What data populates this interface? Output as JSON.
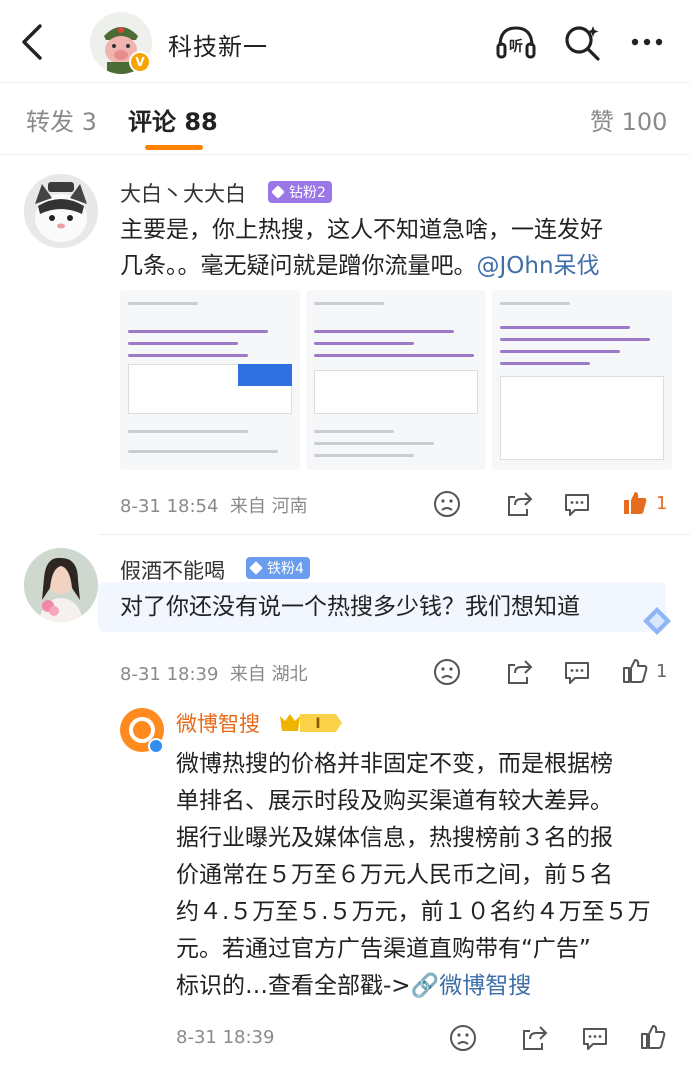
{
  "header": {
    "title": "科技新一",
    "verified_mark": "V",
    "icons": {
      "back": "back-arrow-icon",
      "listen": "listen-icon",
      "search": "search-icon",
      "more": "more-icon"
    },
    "listen_label": "听"
  },
  "tabs": [
    {
      "label": "转发",
      "count": "3"
    },
    {
      "label": "评论",
      "count": "88",
      "active": true
    },
    {
      "label": "赞",
      "count": "100"
    }
  ],
  "accent_color": "#ff8200",
  "comments": [
    {
      "user": "大白丶大大白",
      "fan_badge": "钻粉2",
      "badge_color": "#9a77e6",
      "text_line1": "主要是，你上热搜，这人不知道急啥，一连发好",
      "text_line2": "几条。。毫无疑问就是蹭你流量吧。",
      "mention": "@JOhn呆伐",
      "time": "8-31 18:54",
      "location": "来自 河南",
      "likes": "1"
    },
    {
      "user": "假酒不能喝",
      "fan_badge": "铁粉4",
      "badge_color": "#6a9cf0",
      "text": "对了你还没有说一个热搜多少钱？我们想知道",
      "time": "8-31 18:39",
      "location": "来自 湖北",
      "likes": "1"
    }
  ],
  "reply": {
    "user": "微博智搜",
    "level": "I",
    "lines": [
      "微博热搜的价格并非固定不变，而是根据榜",
      "单排名、展示时段及购买渠道有较大差异。",
      "据行业曝光及媒体信息，热搜榜前３名的报",
      "价通常在５万至６万元人民币之间，前５名",
      "约４.５万至５.５万元，前１０名约４万至５万",
      "元。若通过官方广告渠道直购带有“广告”"
    ],
    "last_line_text": "标识的…查看全部戳->",
    "link_text": "微博智搜",
    "time": "8-31 18:39"
  }
}
